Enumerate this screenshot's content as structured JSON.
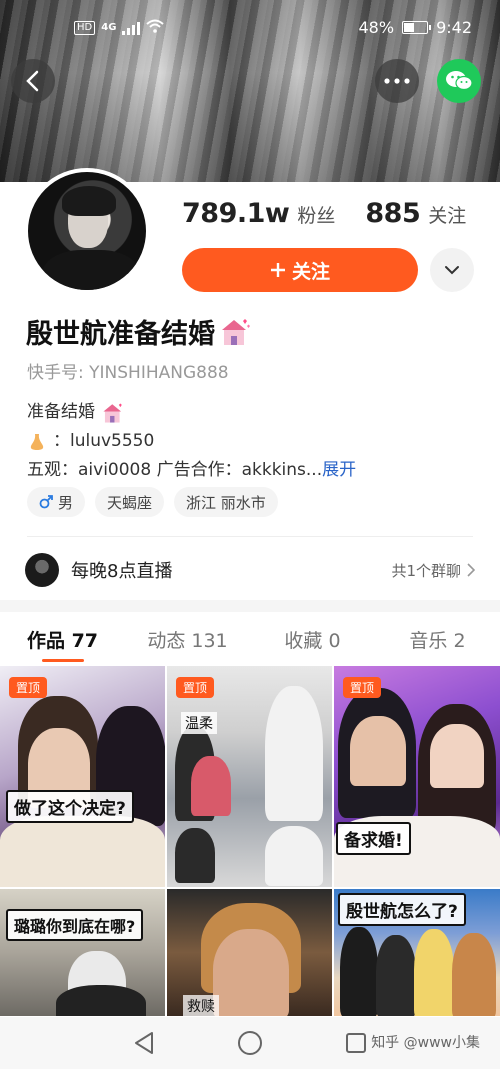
{
  "status_bar": {
    "hd_label": "HD",
    "network": "4G",
    "battery": "48%",
    "battery_fraction": 0.48,
    "time": "9:42"
  },
  "profile": {
    "followers_count": "789.1w",
    "followers_label": "粉丝",
    "following_count": "885",
    "following_label": "关注",
    "follow_button_label": "关注",
    "name": "殷世航准备结婚",
    "id_label": "快手号: YINSHIHANG888",
    "bio_line_1": "准备结婚",
    "bio_line_2": "：luluv5550",
    "bio_line_3": "五观：aivi0008 广告合作：akkkins...",
    "bio_expand": "展开",
    "tags": [
      {
        "icon": "male-icon",
        "label": "男"
      },
      {
        "label": "天蝎座"
      },
      {
        "label": "浙江 丽水市"
      }
    ]
  },
  "live": {
    "text": "每晚8点直播",
    "group_text": "共1个群聊"
  },
  "tabs": [
    {
      "label": "作品 77",
      "active": true
    },
    {
      "label": "动态 131",
      "active": false
    },
    {
      "label": "收藏 0",
      "active": false
    },
    {
      "label": "音乐 2",
      "active": false
    }
  ],
  "videos": [
    {
      "pinned": "置顶",
      "caption": "做了这个决定?"
    },
    {
      "pinned": "置顶",
      "caption": "温柔"
    },
    {
      "pinned": "置顶",
      "caption": "备求婚!"
    },
    {
      "caption": "璐璐你到底在哪?"
    },
    {
      "caption": "救赎"
    },
    {
      "caption": "殷世航怎么了?"
    }
  ],
  "watermark": "知乎 @www小集",
  "colors": {
    "accent": "#ff5a1f",
    "wechat": "#1fc95a",
    "link": "#2a64c8"
  }
}
